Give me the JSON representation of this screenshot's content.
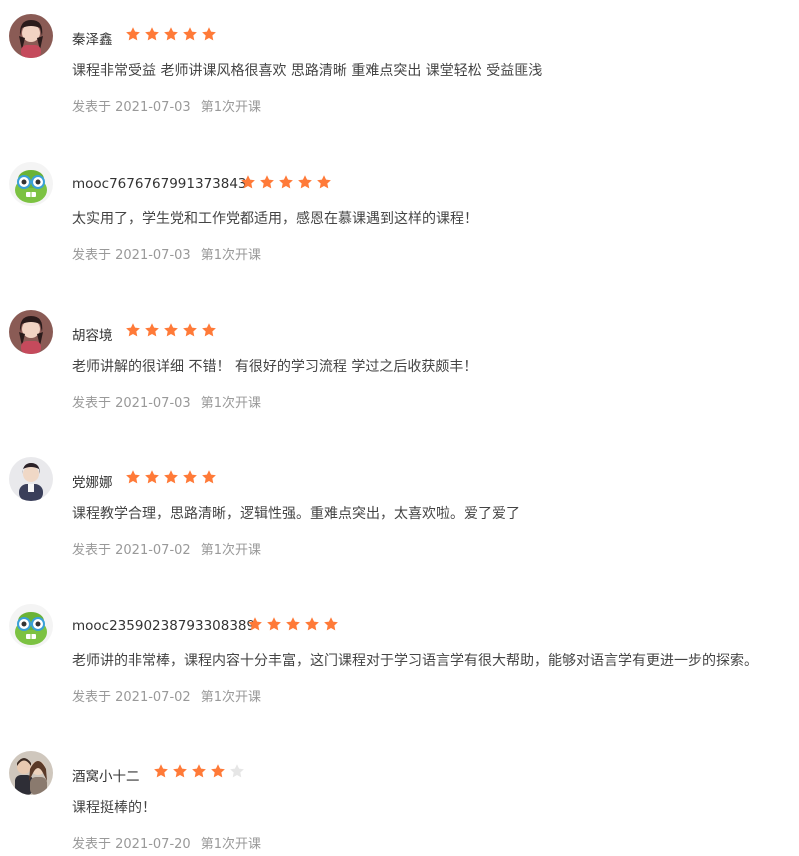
{
  "colors": {
    "star_filled": "#ff7a38",
    "star_empty": "#e6e6e6",
    "meta_text": "#999999",
    "content_text": "#444444",
    "username_text": "#333333"
  },
  "reviews": [
    {
      "username": "秦泽鑫",
      "rating": 5,
      "avatar": "photo-avatar-woman",
      "content": "课程非常受益 老师讲课风格很喜欢 思路清晰 重难点突出 课堂轻松 受益匪浅",
      "posted": "发表于 2021-07-03",
      "session": "第1次开课"
    },
    {
      "username": "mooc7676767991373843",
      "rating": 5,
      "avatar": "default-mooc-monster-avatar",
      "content": "太实用了，学生党和工作党都适用，感恩在慕课遇到这样的课程！",
      "posted": "发表于 2021-07-03",
      "session": "第1次开课"
    },
    {
      "username": "胡容境",
      "rating": 5,
      "avatar": "photo-avatar-woman",
      "content": "老师讲解的很详细 不错！ 有很好的学习流程 学过之后收获颇丰！",
      "posted": "发表于 2021-07-03",
      "session": "第1次开课"
    },
    {
      "username": "党娜娜",
      "rating": 5,
      "avatar": "photo-avatar-girl",
      "content": "课程教学合理，思路清晰，逻辑性强。重难点突出，太喜欢啦。爱了爱了",
      "posted": "发表于 2021-07-02",
      "session": "第1次开课"
    },
    {
      "username": "mooc23590238793308389",
      "rating": 5,
      "avatar": "default-mooc-monster-avatar",
      "content": "老师讲的非常棒，课程内容十分丰富，这门课程对于学习语言学有很大帮助，能够对语言学有更进一步的探索。",
      "posted": "发表于 2021-07-02",
      "session": "第1次开课"
    },
    {
      "username": "酒窝小十二",
      "rating": 4,
      "avatar": "photo-avatar-couple",
      "content": "课程挺棒的！",
      "posted": "发表于 2021-07-20",
      "session": "第1次开课"
    }
  ]
}
